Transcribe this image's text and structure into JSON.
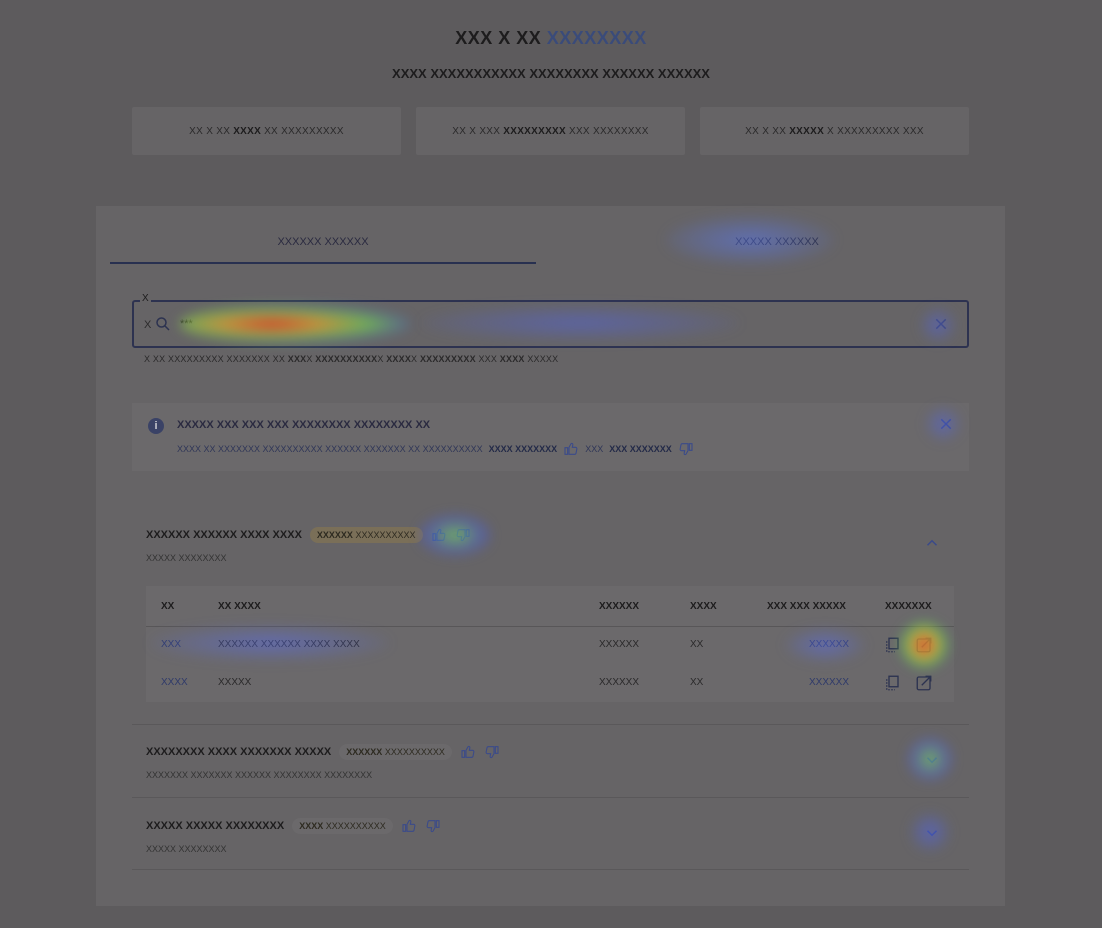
{
  "header": {
    "title_main": "XXX X XX",
    "title_accent": "XXXXXXXX",
    "subtitle": "XXXX XXXXXXXXXXX XXXXXXXX XXXXXX XXXXXX"
  },
  "stats": [
    {
      "pre": "XX X XX",
      "bold": "XXXX",
      "post": "XX XXXXXXXXX"
    },
    {
      "pre": "XX X XXX",
      "bold": "XXXXXXXXX",
      "post": "XXX XXXXXXXX"
    },
    {
      "pre": "XX X XX",
      "bold": "XXXXX",
      "post": "X XXXXXXXXX XXX"
    }
  ],
  "tabs": [
    {
      "label": "XXXXXX XXXXXX"
    },
    {
      "label": "XXXXX XXXXXX"
    }
  ],
  "search": {
    "label": "X",
    "prefix": "X",
    "value": "***",
    "hint_parts": {
      "a": "X XX XXXXXXXXX XXXXXXX XX",
      "b1": "XXX",
      "c1": "X",
      "b2": "XXXXXXXXXX",
      "c2": "X",
      "b3": "XXXX",
      "c3": "X",
      "b4": "XXXXXXXXX",
      "c4": "XXX",
      "b5": "XXXX",
      "c5": "XXXXX"
    }
  },
  "info": {
    "icon": "info-icon",
    "title": "XXXXX XXX XXX XXX XXXXXXXX XXXXXXXX XX",
    "body": "XXXX XX XXXXXXX XXXXXXXXXX XXXXXX XXXXXXX XX XXXXXXXXXX",
    "yes_label": "XXXX XXXXXXX",
    "mid": "XXX",
    "no_label": "XXX XXXXXXX"
  },
  "groups": [
    {
      "title": "XXXXXX XXXXXX XXXX XXXX",
      "badge_bold": "XXXXXX",
      "badge_rest": "XXXXXXXXXX",
      "subtitle": "XXXXX XXXXXXXX",
      "expanded": true
    },
    {
      "title": "XXXXXXXX XXXX XXXXXXX XXXXX",
      "badge_bold": "XXXXXX",
      "badge_rest": "XXXXXXXXXX",
      "subtitle": "XXXXXXX XXXXXXX XXXXXX XXXXXXXX XXXXXXXX",
      "expanded": false
    },
    {
      "title": "XXXXX XXXXX XXXXXXXX",
      "badge_bold": "XXXX",
      "badge_rest": "XXXXXXXXXX",
      "subtitle": "XXXXX XXXXXXXX",
      "expanded": false
    }
  ],
  "table": {
    "headers": [
      "XX",
      "XX XXXX",
      "XXXXXX",
      "XXXX",
      "XXX XXX XXXXX",
      "XXXXXXX"
    ],
    "rows": [
      {
        "id": "XXX",
        "name": "XXXXXX XXXXXX XXXX XXXX",
        "c3": "XXXXXX",
        "c4": "XX",
        "c5": "XXXXXX"
      },
      {
        "id": "XXXX",
        "name": "XXXXX",
        "c3": "XXXXXX",
        "c4": "XX",
        "c5": "XXXXXX"
      }
    ]
  },
  "colors": {
    "accent": "#3a4b7a",
    "background": "#5d5b5d",
    "panel": "#666466"
  }
}
